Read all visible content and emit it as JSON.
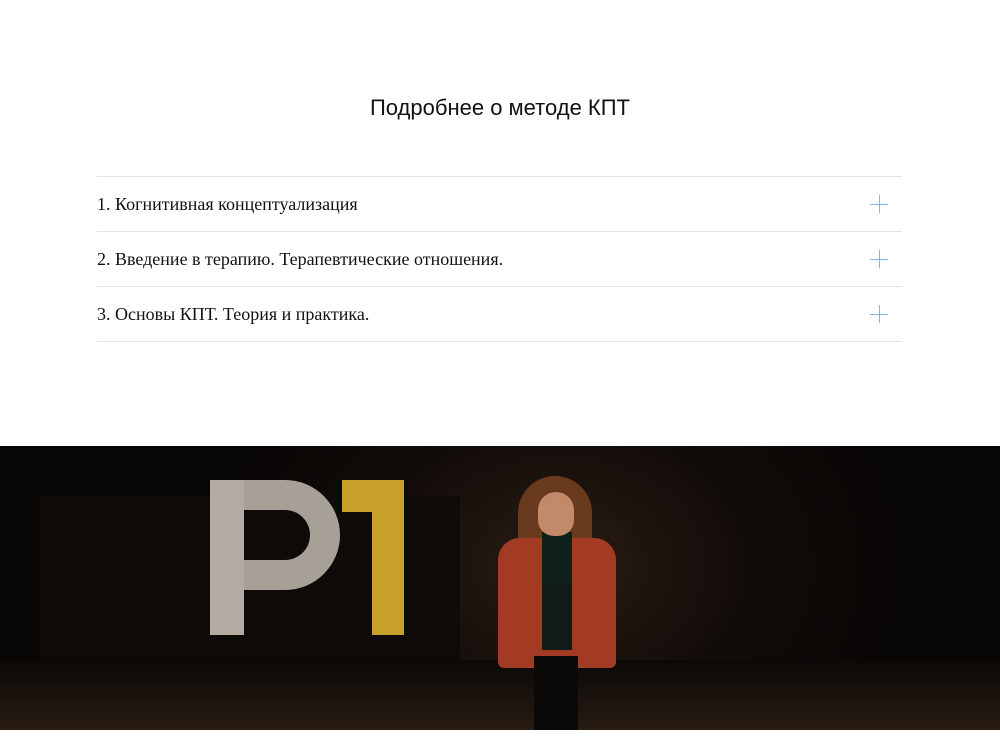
{
  "section": {
    "title": "Подробнее о методе КПТ"
  },
  "accordion": {
    "items": [
      {
        "label": "1. Когнитивная концептуализация",
        "icon": "plus-icon"
      },
      {
        "label": "2. Введение в терапию. Терапевтические отношения.",
        "icon": "plus-icon"
      },
      {
        "label": "3. Основы КПТ. Теория и практика.",
        "icon": "plus-icon"
      }
    ]
  },
  "photo": {
    "sign_text": "P1"
  },
  "colors": {
    "accent": "#7fb6df",
    "divider": "#e3e3e3",
    "text": "#111111",
    "sign_yellow": "#c8a12c",
    "coat_red": "#a33b24"
  }
}
